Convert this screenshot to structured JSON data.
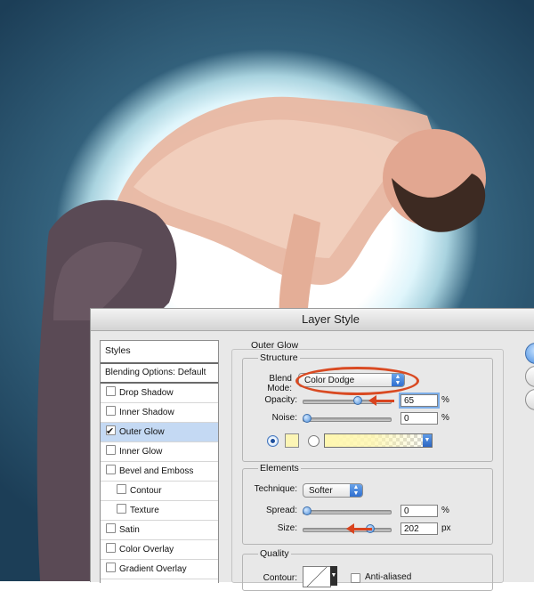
{
  "dialog": {
    "title": "Layer Style"
  },
  "styles_list": {
    "header": "Styles",
    "blending_options": "Blending Options: Default",
    "items": [
      {
        "label": "Drop Shadow",
        "checked": false,
        "sub": false
      },
      {
        "label": "Inner Shadow",
        "checked": false,
        "sub": false
      },
      {
        "label": "Outer Glow",
        "checked": true,
        "sub": false,
        "selected": true
      },
      {
        "label": "Inner Glow",
        "checked": false,
        "sub": false
      },
      {
        "label": "Bevel and Emboss",
        "checked": false,
        "sub": false
      },
      {
        "label": "Contour",
        "checked": false,
        "sub": true
      },
      {
        "label": "Texture",
        "checked": false,
        "sub": true
      },
      {
        "label": "Satin",
        "checked": false,
        "sub": false
      },
      {
        "label": "Color Overlay",
        "checked": false,
        "sub": false
      },
      {
        "label": "Gradient Overlay",
        "checked": false,
        "sub": false
      }
    ]
  },
  "outer_glow": {
    "title": "Outer Glow",
    "structure": {
      "title": "Structure",
      "blend_mode_label": "Blend Mode:",
      "blend_mode_value": "Color Dodge",
      "opacity_label": "Opacity:",
      "opacity_value": "65",
      "opacity_unit": "%",
      "opacity_fraction": 0.65,
      "noise_label": "Noise:",
      "noise_value": "0",
      "noise_unit": "%",
      "noise_fraction": 0
    },
    "elements": {
      "title": "Elements",
      "technique_label": "Technique:",
      "technique_value": "Softer",
      "spread_label": "Spread:",
      "spread_value": "0",
      "spread_unit": "%",
      "spread_fraction": 0,
      "size_label": "Size:",
      "size_value": "202",
      "size_unit": "px",
      "size_fraction": 0.81
    },
    "quality": {
      "title": "Quality",
      "contour_label": "Contour:",
      "anti_aliased_label": "Anti-aliased"
    }
  },
  "colors": {
    "glow_color": "#fcf5b5",
    "annotation_red": "#d9441f",
    "selection_blue": "#c4d9f3"
  }
}
